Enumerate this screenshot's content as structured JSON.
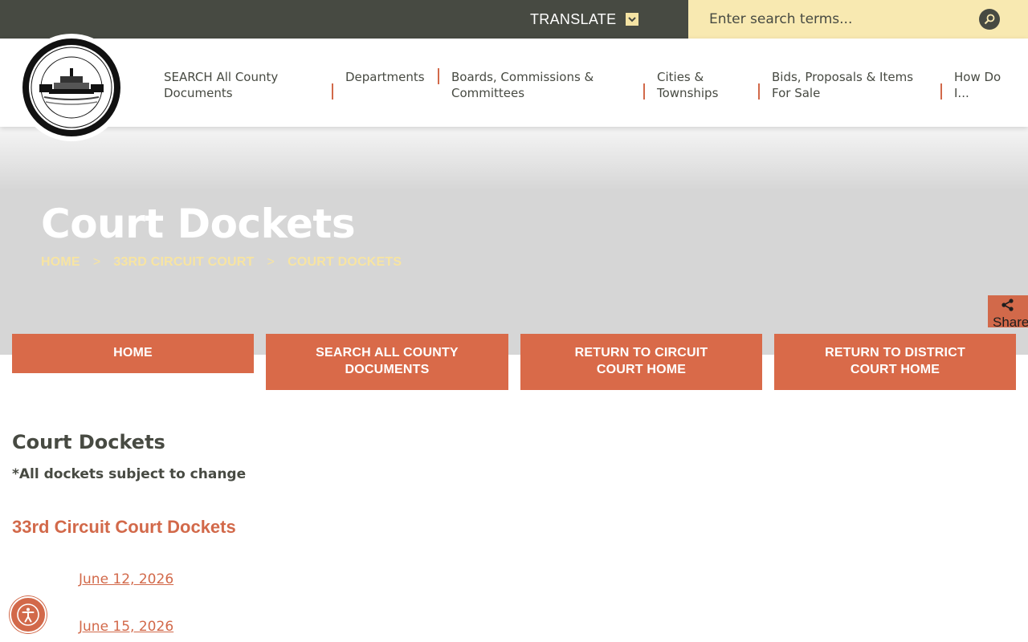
{
  "topbar": {
    "translate_label": "TRANSLATE",
    "search_placeholder": "Enter search terms..."
  },
  "nav": {
    "items": [
      {
        "line1": "SEARCH All County",
        "line2": "Documents"
      },
      {
        "line1": "Departments",
        "line2": ""
      },
      {
        "line1": "Boards, Commissions &",
        "line2": "Committees"
      },
      {
        "line1": "Cities &",
        "line2": "Townships"
      },
      {
        "line1": "Bids, Proposals & Items",
        "line2": "For Sale"
      },
      {
        "line1": "How Do",
        "line2": "I..."
      }
    ]
  },
  "hero": {
    "title": "Court Dockets",
    "breadcrumbs": [
      "HOME",
      "33RD CIRCUIT COURT",
      "COURT DOCKETS"
    ],
    "separator": ">"
  },
  "share": {
    "label": "Share"
  },
  "quick_buttons": [
    {
      "line1": "HOME",
      "line2": ""
    },
    {
      "line1": "SEARCH ALL COUNTY",
      "line2": "DOCUMENTS"
    },
    {
      "line1": "RETURN TO CIRCUIT",
      "line2": "COURT HOME"
    },
    {
      "line1": "RETURN TO DISTRICT",
      "line2": "COURT HOME"
    }
  ],
  "content": {
    "title": "Court Dockets",
    "note": "*All dockets subject to change",
    "section_title": "33rd Circuit Court Dockets",
    "dockets": [
      "June 12, 2026",
      "June 15, 2026"
    ]
  },
  "colors": {
    "accent": "#d2694a",
    "dark": "#474a42",
    "cream": "#f8e9b1"
  }
}
